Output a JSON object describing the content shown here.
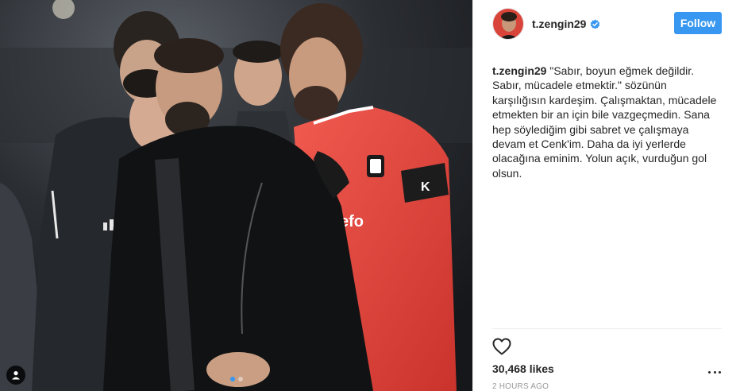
{
  "post": {
    "media": {
      "image_alt": "",
      "carousel_dots": 2,
      "active_dot": 0,
      "jersey_text": "...efo..."
    },
    "header": {
      "username": "t.zengin29",
      "verified": true,
      "follow_label": "Follow"
    },
    "caption": {
      "username": "t.zengin29",
      "text": " \"Sabır, boyun eğmek değildir. Sabır, mücadele etmektir.\" sözünün karşılığısın kardeşim. Çalışmaktan, mücadele etmekten bir an için bile vazgeçmedin. Sana hep söylediğim gibi sabret ve çalışmaya devam et Cenk'im. Daha da iyi yerlerde olacağına eminim. Yolun açık, vurduğun gol olsun."
    },
    "actions": {
      "like_icon": "heart-icon",
      "likes": "30,468 likes",
      "more_icon": "more-options-icon",
      "timestamp": "2 HOURS AGO"
    },
    "colors": {
      "follow_bg": "#3897f0",
      "verified_blue": "#3897f0",
      "jersey_red": "#e8453c"
    }
  }
}
